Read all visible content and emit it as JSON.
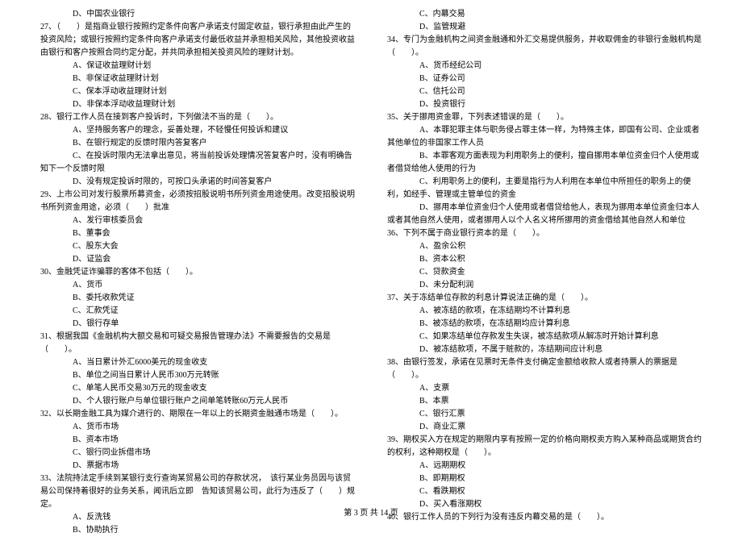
{
  "left": [
    {
      "indent": 2,
      "text": "D、中国农业银行"
    },
    {
      "indent": 0,
      "text": "27、（　　）是指商业银行按照约定条件向客户承诺支付固定收益，银行承担由此产生的投资风险；或银行按照约定条件向客户承诺支付最低收益并承担相关风险，其他投资收益由银行和客户按照合同约定分配，并共同承担相关投资风险的理财计划。"
    },
    {
      "indent": 2,
      "text": "A、保证收益理财计划"
    },
    {
      "indent": 2,
      "text": "B、非保证收益理财计划"
    },
    {
      "indent": 2,
      "text": "C、保本浮动收益理财计划"
    },
    {
      "indent": 2,
      "text": "D、非保本浮动收益理财计划"
    },
    {
      "indent": 0,
      "text": "28、银行工作人员在接到客户投诉时，下列做法不当的是（　　）。"
    },
    {
      "indent": 2,
      "text": "A、坚持服务客户的理念，妥善处理，不轻慢任何投诉和建议"
    },
    {
      "indent": 2,
      "text": "B、在银行规定的反馈时限内答复客户"
    },
    {
      "indent": 2,
      "text": "C、在投诉时限内无法拿出意见，将当前投诉处理情况答复客户时，没有明确告知下一个反馈时限"
    },
    {
      "indent": 2,
      "text": "D、没有规定投诉时限的，可按口头承诺的时间答复客户"
    },
    {
      "indent": 0,
      "text": "29、上市公司对发行股票所募资金，必须按招股说明书所列资金用途使用。改变招股说明书所列资金用途，必须（　　）批准"
    },
    {
      "indent": 2,
      "text": "A、发行审核委员会"
    },
    {
      "indent": 2,
      "text": "B、董事会"
    },
    {
      "indent": 2,
      "text": "C、股东大会"
    },
    {
      "indent": 2,
      "text": "D、证监会"
    },
    {
      "indent": 0,
      "text": "30、金融凭证诈骗罪的客体不包括（　　）。"
    },
    {
      "indent": 2,
      "text": "A、货币"
    },
    {
      "indent": 2,
      "text": "B、委托收款凭证"
    },
    {
      "indent": 2,
      "text": "C、汇款凭证"
    },
    {
      "indent": 2,
      "text": "D、银行存单"
    },
    {
      "indent": 0,
      "text": "31、根据我国《金融机构大额交易和可疑交易报告管理办法》不需要报告的交易是（　　）。"
    },
    {
      "indent": 2,
      "text": "A、当日累计外汇6000美元的现金收支"
    },
    {
      "indent": 2,
      "text": "B、单位之间当日累计人民币300万元转账"
    },
    {
      "indent": 2,
      "text": "C、单笔人民币交易30万元的现金收支"
    },
    {
      "indent": 2,
      "text": "D、个人银行账户与单位银行账户之间单笔转账60万元人民币"
    },
    {
      "indent": 0,
      "text": "32、以长期金融工具为媒介进行的、期限在一年以上的长期资金融通市场是（　　）。"
    },
    {
      "indent": 2,
      "text": "A、货币市场"
    },
    {
      "indent": 2,
      "text": "B、资本市场"
    },
    {
      "indent": 2,
      "text": "C、银行同业拆借市场"
    },
    {
      "indent": 2,
      "text": "D、票据市场"
    },
    {
      "indent": 0,
      "text": "33、法院持法定手续到某银行支行查询某贸易公司的存款状况，　该行某业务员因与该贸易公司保持着很好的业务关系，闻讯后立即　告知该贸易公司，此行为违反了（　　）规定。"
    },
    {
      "indent": 2,
      "text": "A、反洗钱"
    },
    {
      "indent": 2,
      "text": "B、协助执行"
    }
  ],
  "right": [
    {
      "indent": 2,
      "text": "C、内幕交易"
    },
    {
      "indent": 2,
      "text": "D、监管规避"
    },
    {
      "indent": 0,
      "text": "34、专门为金融机构之间资金融通和外汇交易提供服务，并收取佣金的非银行金融机构是（　　）。"
    },
    {
      "indent": 2,
      "text": "A、货币经纪公司"
    },
    {
      "indent": 2,
      "text": "B、证券公司"
    },
    {
      "indent": 2,
      "text": "C、信托公司"
    },
    {
      "indent": 2,
      "text": "D、投资银行"
    },
    {
      "indent": 0,
      "text": "35、关于挪用资金罪，下列表述错误的是（　　）。"
    },
    {
      "indent": 2,
      "text": "A、本罪犯罪主体与职务侵占罪主体一样，为特殊主体，即国有公司、企业或者其他单位的非国家工作人员"
    },
    {
      "indent": 2,
      "text": "B、本罪客观方面表现为利用职务上的便利，擅自挪用本单位资金归个人使用或者借贷给他人使用的行为"
    },
    {
      "indent": 2,
      "text": "C、利用职务上的便利，主要是指行为人利用在本单位中所担任的职务上的便利，如经手、管理或主管单位的资金"
    },
    {
      "indent": 2,
      "text": "D、挪用本单位资金归个人使用或者借贷给他人，表现为挪用本单位资金归本人或者其他自然人使用，或者挪用人以个人名义将所挪用的资金借给其他自然人和单位"
    },
    {
      "indent": 0,
      "text": "36、下列不属于商业银行资本的是（　　）。"
    },
    {
      "indent": 2,
      "text": "A、盈余公积"
    },
    {
      "indent": 2,
      "text": "B、资本公积"
    },
    {
      "indent": 2,
      "text": "C、贷款资金"
    },
    {
      "indent": 2,
      "text": "D、未分配利润"
    },
    {
      "indent": 0,
      "text": "37、关于冻结单位存款的利息计算说法正确的是（　　）。"
    },
    {
      "indent": 2,
      "text": "A、被冻结的款项，在冻结期均不计算利息"
    },
    {
      "indent": 2,
      "text": "B、被冻结的款项，在冻结期均应计算利息"
    },
    {
      "indent": 2,
      "text": "C、如果冻结单位存款发生失误，被冻结款项从解冻时开始计算利息"
    },
    {
      "indent": 2,
      "text": "D、被冻结款项，不属于赃款的，冻结期间应计利息"
    },
    {
      "indent": 0,
      "text": "38、由银行签发，承诺在见票时无条件支付确定金额给收款人或者持票人的票据是（　　）。"
    },
    {
      "indent": 2,
      "text": "A、支票"
    },
    {
      "indent": 2,
      "text": "B、本票"
    },
    {
      "indent": 2,
      "text": "C、银行汇票"
    },
    {
      "indent": 2,
      "text": "D、商业汇票"
    },
    {
      "indent": 0,
      "text": "39、期权买入方在规定的期限内享有按照一定的价格向期权卖方购入某种商品或期货合约的权利，这种期权是（　　）。"
    },
    {
      "indent": 2,
      "text": "A、远期期权"
    },
    {
      "indent": 2,
      "text": "B、即期期权"
    },
    {
      "indent": 2,
      "text": "C、看跌期权"
    },
    {
      "indent": 2,
      "text": "D、买入看涨期权"
    },
    {
      "indent": 0,
      "text": "40、银行工作人员的下列行为没有违反内幕交易的是（　　）。"
    }
  ],
  "footer": "第 3 页 共 14 页"
}
